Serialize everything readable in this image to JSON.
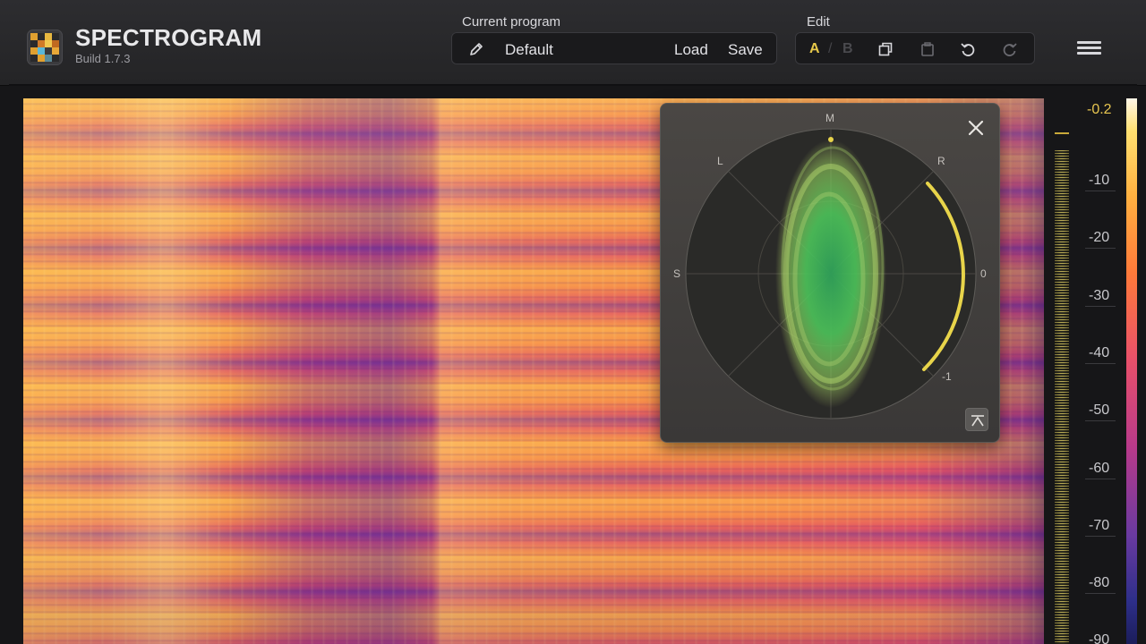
{
  "app": {
    "title": "SPECTROGRAM",
    "build": "Build 1.7.3"
  },
  "program": {
    "section_label": "Current program",
    "name": "Default",
    "load_label": "Load",
    "save_label": "Save",
    "edit_icon": "pencil-icon"
  },
  "edit": {
    "section_label": "Edit",
    "a_label": "A",
    "separator": "/",
    "b_label": "B",
    "icons": [
      "copy-icon",
      "paste-icon",
      "undo-icon",
      "redo-icon"
    ]
  },
  "menu": {
    "icon": "hamburger-menu-icon"
  },
  "meter": {
    "peak_value": "-0.2",
    "scale": [
      "-10",
      "-20",
      "-30",
      "-40",
      "-50",
      "-60",
      "-70",
      "-80",
      "-90"
    ]
  },
  "vectorscope": {
    "labels": {
      "m": "M",
      "l": "L",
      "r": "R",
      "s": "S",
      "zero": "0",
      "minus_one": "-1"
    },
    "close_icon": "close-icon",
    "mode_icon": "scope-mode-icon"
  },
  "colors": {
    "accent": "#e6c84a",
    "scope_green": "#6ad05a",
    "correlation_arc": "#e8d44a",
    "background": "#161618"
  }
}
